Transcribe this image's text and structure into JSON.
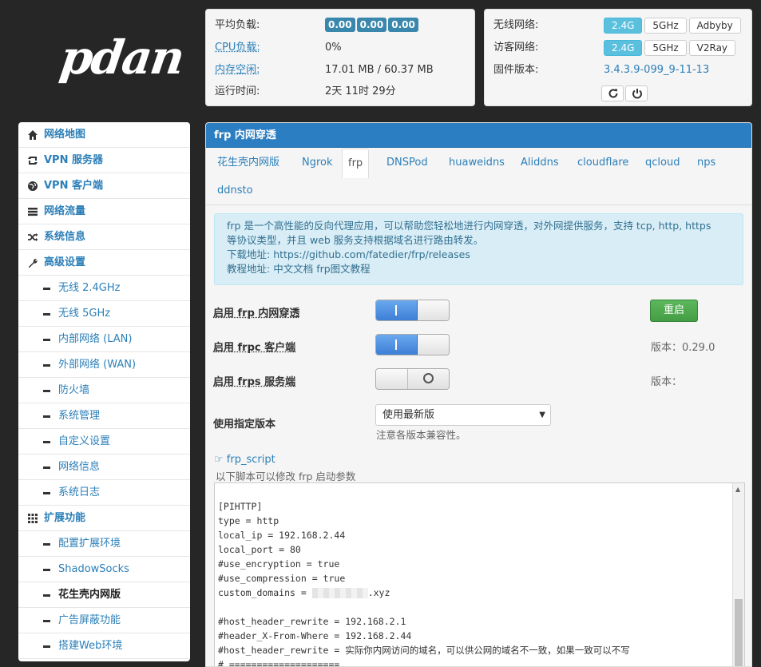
{
  "brand": {
    "logo_text": "pdan"
  },
  "status_left": {
    "load_label": "平均负载:",
    "load_values": [
      "0.00",
      "0.00",
      "0.00"
    ],
    "cpu_label": "CPU负载:",
    "cpu_value": "0%",
    "mem_label": "内存空闲:",
    "mem_value": "17.01 MB / 60.37 MB",
    "uptime_label": "运行时间:",
    "uptime_value": "2天 11时 29分"
  },
  "status_right": {
    "wireless_label": "无线网络:",
    "wireless_buttons": [
      "2.4G",
      "5GHz",
      "Adbyby"
    ],
    "guest_label": "访客网络:",
    "guest_buttons": [
      "2.4G",
      "5GHz",
      "V2Ray"
    ],
    "firmware_label": "固件版本:",
    "firmware_value": "3.4.3.9-099_9-11-13"
  },
  "sidebar": {
    "items": [
      {
        "label": "网络地图",
        "icon": "home-icon"
      },
      {
        "label": "VPN 服务器",
        "icon": "retweet-icon"
      },
      {
        "label": "VPN 客户端",
        "icon": "globe-icon"
      },
      {
        "label": "网络流量",
        "icon": "list-icon"
      },
      {
        "label": "系统信息",
        "icon": "random-icon"
      },
      {
        "label": "高级设置",
        "icon": "wrench-icon"
      },
      {
        "label": "无线 2.4GHz"
      },
      {
        "label": "无线 5GHz"
      },
      {
        "label": "内部网络 (LAN)"
      },
      {
        "label": "外部网络 (WAN)"
      },
      {
        "label": "防火墙"
      },
      {
        "label": "系统管理"
      },
      {
        "label": "自定义设置"
      },
      {
        "label": "网络信息"
      },
      {
        "label": "系统日志"
      },
      {
        "label": "扩展功能",
        "icon": "grid-icon"
      },
      {
        "label": "配置扩展环境"
      },
      {
        "label": "ShadowSocks"
      },
      {
        "label": "花生壳内网版"
      },
      {
        "label": "广告屏蔽功能"
      },
      {
        "label": "搭建Web环境"
      }
    ]
  },
  "main": {
    "title": "frp 内网穿透",
    "tabs": [
      "花生壳内网版",
      "Ngrok",
      "frp",
      "DNSPod",
      "huaweidns",
      "Aliddns",
      "cloudflare",
      "qcloud",
      "nps",
      "ddnsto"
    ],
    "info_line1": "frp 是一个高性能的反向代理应用，可以帮助您轻松地进行内网穿透，对外网提供服务，支持 tcp, http, https",
    "info_line2": "等协议类型，并且 web 服务支持根据域名进行路由转发。",
    "info_dl_label": "下载地址: ",
    "info_dl_url": "https://github.com/fatedier/frp/releases",
    "info_tut_label": "教程地址: ",
    "info_tut_link1": "中文文档",
    "info_tut_link2": "frp图文教程",
    "enable_frp_label": "启用 frp 内网穿透",
    "restart_label": "重启",
    "enable_frpc_label": "启用 frpc 客户端",
    "frpc_version": "版本：0.29.0",
    "enable_frps_label": "启用 frps 服务端",
    "frps_version": "版本：",
    "version_select_label": "使用指定版本",
    "version_select_value": "使用最新版",
    "version_hint": "注意各版本兼容性。",
    "script_title": "frp_script",
    "script_desc": "以下脚本可以修改 frp 启动参数",
    "code_lines": [
      "[PIHTTP]",
      "type = http",
      "local_ip = 192.168.2.44",
      "local_port = 80",
      "#use_encryption = true",
      "#use_compression = true",
      "custom_domains = ",
      "",
      "#host_header_rewrite = 192.168.2.1",
      "#header_X-From-Where = 192.168.2.44",
      "#host_header_rewrite = 实际你内网访问的域名，可以供公网的域名不一致，如果一致可以不写",
      "# ===================="
    ],
    "domain_suffix": ".xyz"
  }
}
